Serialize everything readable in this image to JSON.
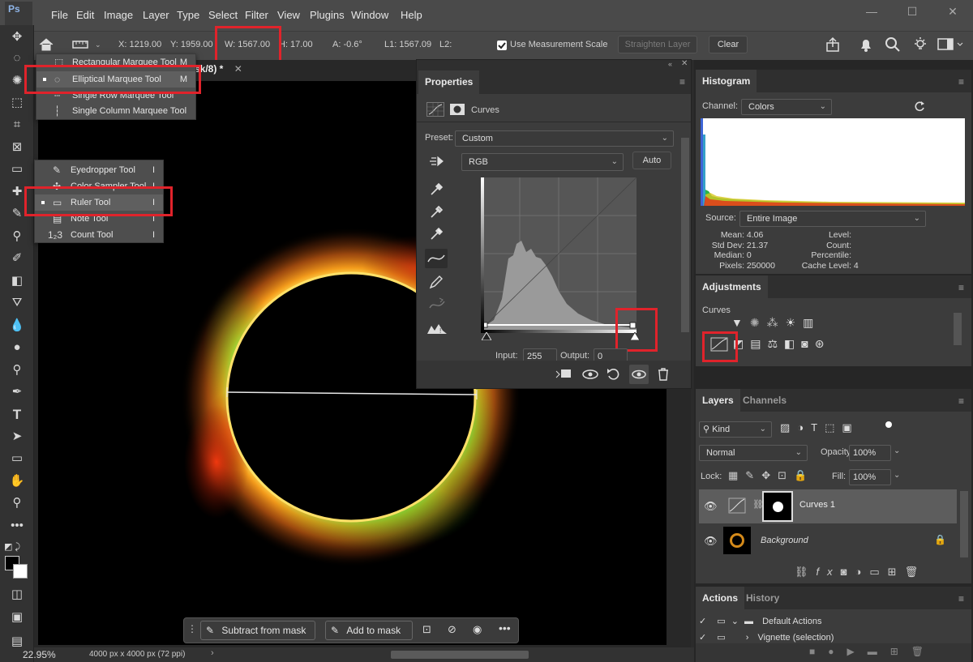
{
  "app": {
    "logo": "Ps"
  },
  "menu": [
    "File",
    "Edit",
    "Image",
    "Layer",
    "Type",
    "Select",
    "Filter",
    "View",
    "Plugins",
    "Window",
    "Help"
  ],
  "window_controls": {
    "minimize": "—",
    "maximize": "☐",
    "close": "✕"
  },
  "options_bar": {
    "x": "X: 1219.00",
    "y": "Y: 1959.00",
    "w": "W: 1567.00",
    "h": "H: 17.00",
    "a": "A: -0.6°",
    "l1": "L1: 1567.09",
    "l2": "L2:",
    "use_measurement_scale": "Use Measurement Scale",
    "straighten": "Straighten Layer",
    "clear": "Clear"
  },
  "document": {
    "tab_title": "sk/8) *",
    "zoom": "22.95%",
    "doc_info": "4000 px x 4000 px (72 ppi)"
  },
  "marquee_flyout": {
    "items": [
      {
        "label": "Rectangular Marquee Tool",
        "key": "M",
        "icon": "rect-marquee-icon"
      },
      {
        "label": "Elliptical Marquee Tool",
        "key": "M",
        "icon": "ellipse-marquee-icon"
      },
      {
        "label": "Single Row Marquee Tool",
        "key": "",
        "icon": "row-marquee-icon"
      },
      {
        "label": "Single Column Marquee Tool",
        "key": "",
        "icon": "column-marquee-icon"
      }
    ]
  },
  "eyedropper_flyout": {
    "items": [
      {
        "label": "Eyedropper Tool",
        "key": "I",
        "icon": "eyedropper-icon"
      },
      {
        "label": "Color Sampler Tool",
        "key": "I",
        "icon": "color-sampler-icon"
      },
      {
        "label": "Ruler Tool",
        "key": "I",
        "icon": "ruler-icon"
      },
      {
        "label": "Note Tool",
        "key": "I",
        "icon": "note-icon"
      },
      {
        "label": "Count Tool",
        "key": "I",
        "icon": "count-icon"
      }
    ]
  },
  "properties": {
    "tab": "Properties",
    "title": "Curves",
    "preset_label": "Preset:",
    "preset_value": "Custom",
    "channel_value": "RGB",
    "auto": "Auto",
    "input_label": "Input:",
    "input_value": "255",
    "output_label": "Output:",
    "output_value": "0"
  },
  "histogram": {
    "tab": "Histogram",
    "channel_label": "Channel:",
    "channel_value": "Colors",
    "source_label": "Source:",
    "source_value": "Entire Image",
    "stats_left": [
      {
        "k": "Mean:",
        "v": "4.06"
      },
      {
        "k": "Std Dev:",
        "v": "21.37"
      },
      {
        "k": "Median:",
        "v": "0"
      },
      {
        "k": "Pixels:",
        "v": "250000"
      }
    ],
    "stats_right": [
      {
        "k": "Level:",
        "v": ""
      },
      {
        "k": "Count:",
        "v": ""
      },
      {
        "k": "Percentile:",
        "v": ""
      },
      {
        "k": "Cache Level:",
        "v": "4"
      }
    ]
  },
  "adjustments": {
    "tab": "Adjustments",
    "hover_label": "Curves"
  },
  "layers": {
    "tabs": [
      "Layers",
      "Channels"
    ],
    "kind": "Kind",
    "blend_mode": "Normal",
    "opacity_label": "Opacity:",
    "opacity_value": "100%",
    "lock_label": "Lock:",
    "fill_label": "Fill:",
    "fill_value": "100%",
    "items": [
      {
        "name": "Curves 1"
      },
      {
        "name": "Background"
      }
    ]
  },
  "actions": {
    "tabs": [
      "Actions",
      "History"
    ],
    "items": [
      "Default Actions",
      "Vignette (selection)"
    ]
  },
  "contextual_taskbar": {
    "subtract": "Subtract from mask",
    "add": "Add to mask"
  }
}
